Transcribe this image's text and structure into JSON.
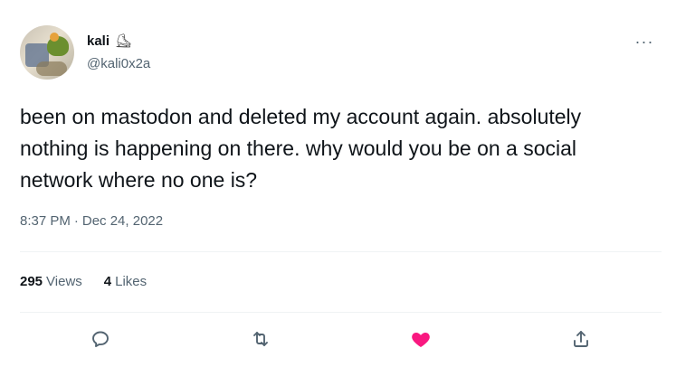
{
  "author": {
    "display_name": "kali",
    "name_emoji": "⛸",
    "handle": "@kali0x2a"
  },
  "more_label": "···",
  "tweet": {
    "text": "been on mastodon and deleted my account again. absolutely nothing is happening on there. why would you be on a social network where no one is?",
    "time": "8:37 PM",
    "separator": "·",
    "date": "Dec 24, 2022"
  },
  "stats": {
    "views_count": "295",
    "views_label": "Views",
    "likes_count": "4",
    "likes_label": "Likes"
  },
  "actions": {
    "reply_icon": "reply-icon",
    "retweet_icon": "retweet-icon",
    "like_icon": "heart-icon",
    "share_icon": "share-icon",
    "like_color": "#f91880",
    "icon_color": "#536471"
  }
}
